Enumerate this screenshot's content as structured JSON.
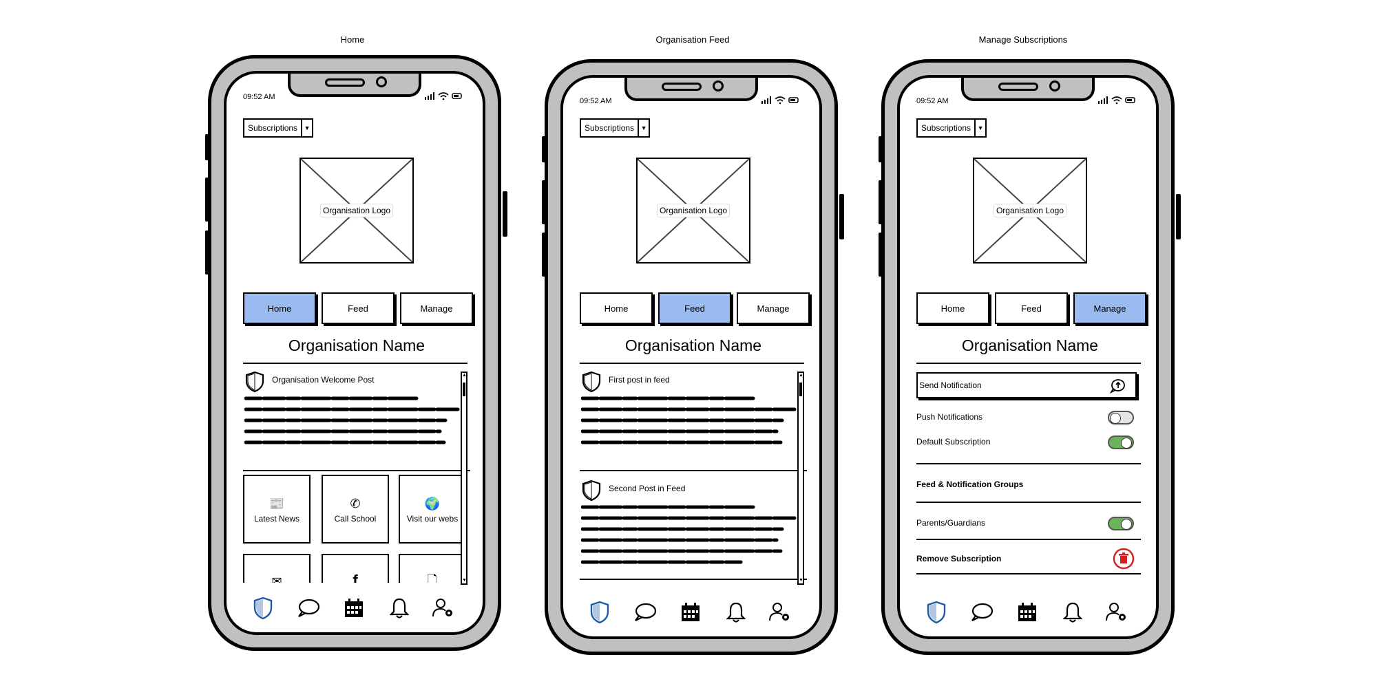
{
  "screens": [
    {
      "title": "Home",
      "status_time": "09:52 AM",
      "dropdown_label": "Subscriptions",
      "logo_label": "Organisation Logo",
      "tabs": [
        "Home",
        "Feed",
        "Manage"
      ],
      "active_tab": 0,
      "org_name": "Organisation Name",
      "post_title": "Organisation Welcome Post",
      "tiles": [
        {
          "label": "Latest News",
          "icon": "newspaper-icon"
        },
        {
          "label": "Call School",
          "icon": "phone-icon"
        },
        {
          "label": "Visit our webs",
          "icon": "globe-icon"
        },
        {
          "label": "",
          "icon": "envelope-icon"
        },
        {
          "label": "",
          "icon": "facebook-icon"
        },
        {
          "label": "",
          "icon": "document-icon"
        }
      ]
    },
    {
      "title": "Organisation Feed",
      "status_time": "09:52 AM",
      "dropdown_label": "Subscriptions",
      "logo_label": "Organisation Logo",
      "tabs": [
        "Home",
        "Feed",
        "Manage"
      ],
      "active_tab": 1,
      "org_name": "Organisation Name",
      "posts": [
        "First post in feed",
        "Second Post in Feed"
      ]
    },
    {
      "title": "Manage Subscriptions",
      "status_time": "09:52 AM",
      "dropdown_label": "Subscriptions",
      "logo_label": "Organisation Logo",
      "tabs": [
        "Home",
        "Feed",
        "Manage"
      ],
      "active_tab": 2,
      "org_name": "Organisation Name",
      "send_notification": "Send Notification",
      "push_notifications": {
        "label": "Push Notifications",
        "on": false
      },
      "default_subscription": {
        "label": "Default Subscription",
        "on": true
      },
      "groups_heading": "Feed & Notification Groups",
      "parents_guardians": {
        "label": "Parents/Guardians",
        "on": true
      },
      "remove_subscription": "Remove Subscription"
    }
  ],
  "bottom_nav": [
    "shield-icon",
    "chat-icon",
    "calendar-icon",
    "bell-icon",
    "user-settings-icon"
  ],
  "colors": {
    "active_tab": "#99bbf0",
    "toggle_on": "#6bb35a",
    "shield_blue": "#1f5ba6",
    "remove_red": "#d42020",
    "phone_frame": "#c0c0c0"
  }
}
